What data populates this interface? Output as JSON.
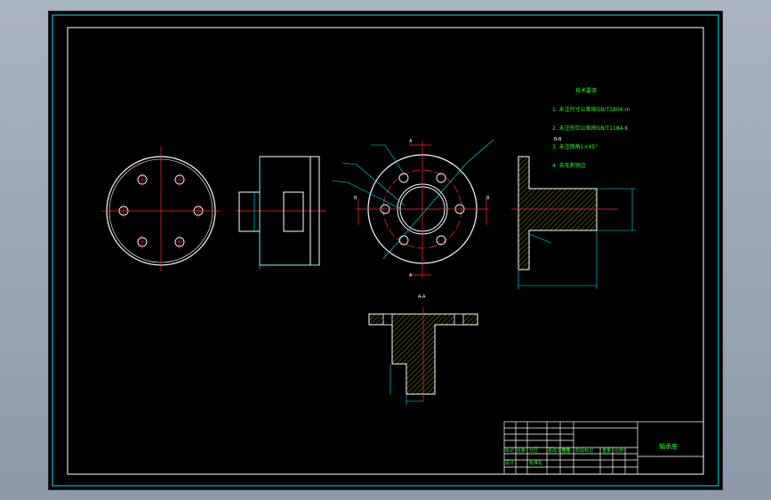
{
  "technical_requirements": {
    "title": "技术要求",
    "items": [
      "1. 未注尺寸公差按GB/T1804-m",
      "2. 未注形位公差按GB/T1184-K",
      "3. 未注倒角1×45°",
      "4. 去毛刺锐边"
    ]
  },
  "views": {
    "section_aa_label": "A-A",
    "section_bb_label": "B-B",
    "cut_markers": [
      "A",
      "A",
      "B",
      "B"
    ]
  },
  "title_block": {
    "part_name": "轴承座",
    "row_labels": [
      "标记",
      "处数",
      "分区",
      "更改文件号",
      "签名",
      "年月日"
    ],
    "row2_labels": [
      "设计",
      "标准化"
    ],
    "stage_labels": [
      "阶段标记",
      "重量",
      "比例"
    ]
  },
  "colors": {
    "outline": "#ffffff",
    "centerline": "#ff2a2a",
    "dimension": "#00e5ff",
    "annotation": "#2aff2a",
    "hatch": "#e0e040"
  }
}
